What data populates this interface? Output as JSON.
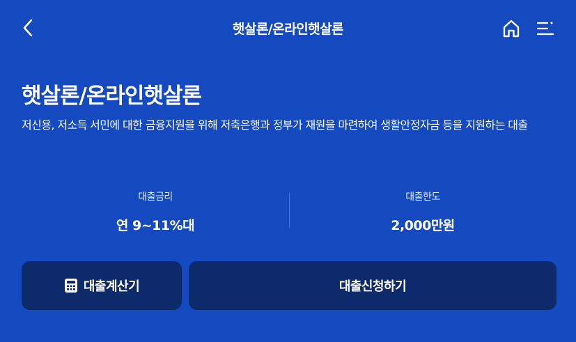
{
  "header": {
    "title": "햇살론/온라인햇살론"
  },
  "main": {
    "title": "햇살론/온라인햇살론",
    "description": "저신용, 저소득 서민에 대한 금융지원을 위해 저축은행과 정부가 재원을 마련하여 생활안정자금 등을 지원하는 대출",
    "stats": [
      {
        "label": "대출금리",
        "value": "연 9~11%대"
      },
      {
        "label": "대출한도",
        "value": "2,000만원"
      }
    ]
  },
  "actions": {
    "calculator_label": "대출계산기",
    "apply_label": "대출신청하기"
  },
  "colors": {
    "background": "#1449C0",
    "button": "#0D2A6B",
    "text": "#FFFFFF"
  },
  "icons": {
    "back": "chevron-left-icon",
    "home": "home-icon",
    "menu": "menu-icon",
    "calculator": "calculator-icon"
  }
}
